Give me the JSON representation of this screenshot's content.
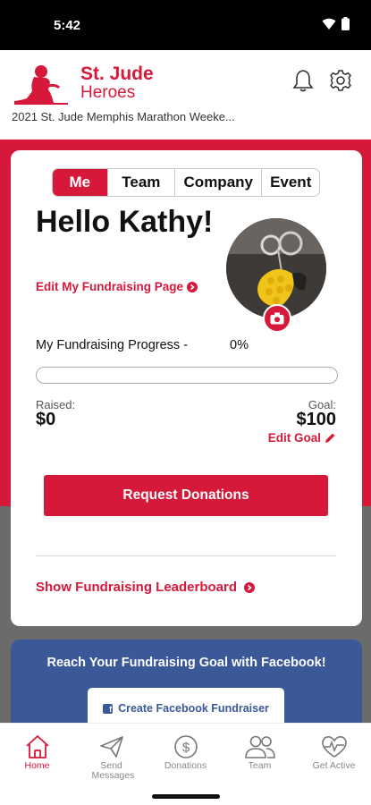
{
  "status_bar": {
    "time": "5:42"
  },
  "header": {
    "brand_line1": "St. Jude",
    "brand_line2": "Heroes",
    "event_name": "2021 St. Jude Memphis Marathon Weeke..."
  },
  "tabs": [
    {
      "label": "Me",
      "active": true
    },
    {
      "label": "Team",
      "active": false
    },
    {
      "label": "Company",
      "active": false
    },
    {
      "label": "Event",
      "active": false
    }
  ],
  "profile": {
    "greeting": "Hello Kathy!",
    "edit_page_label": "Edit My Fundraising Page"
  },
  "progress": {
    "label": "My Fundraising Progress -",
    "percent_text": "0%",
    "fraction": 0
  },
  "fundraising": {
    "raised_label": "Raised:",
    "raised_value": "$0",
    "goal_label": "Goal:",
    "goal_value": "$100",
    "edit_goal_label": "Edit Goal"
  },
  "actions": {
    "request_donations": "Request Donations",
    "leaderboard": "Show Fundraising Leaderboard"
  },
  "facebook": {
    "title": "Reach Your Fundraising Goal with Facebook!",
    "button_label": "Create Facebook Fundraiser"
  },
  "bottom_nav": [
    {
      "label": "Home",
      "icon": "home-icon",
      "active": true
    },
    {
      "label": "Send Messages",
      "icon": "paper-plane-icon",
      "active": false
    },
    {
      "label": "Donations",
      "icon": "dollar-circle-icon",
      "active": false
    },
    {
      "label": "Team",
      "icon": "people-icon",
      "active": false
    },
    {
      "label": "Get Active",
      "icon": "heart-pulse-icon",
      "active": false
    }
  ],
  "colors": {
    "brand_red": "#d6193a",
    "facebook_blue": "#3b5998",
    "backdrop_gray": "#6b6b6b"
  }
}
